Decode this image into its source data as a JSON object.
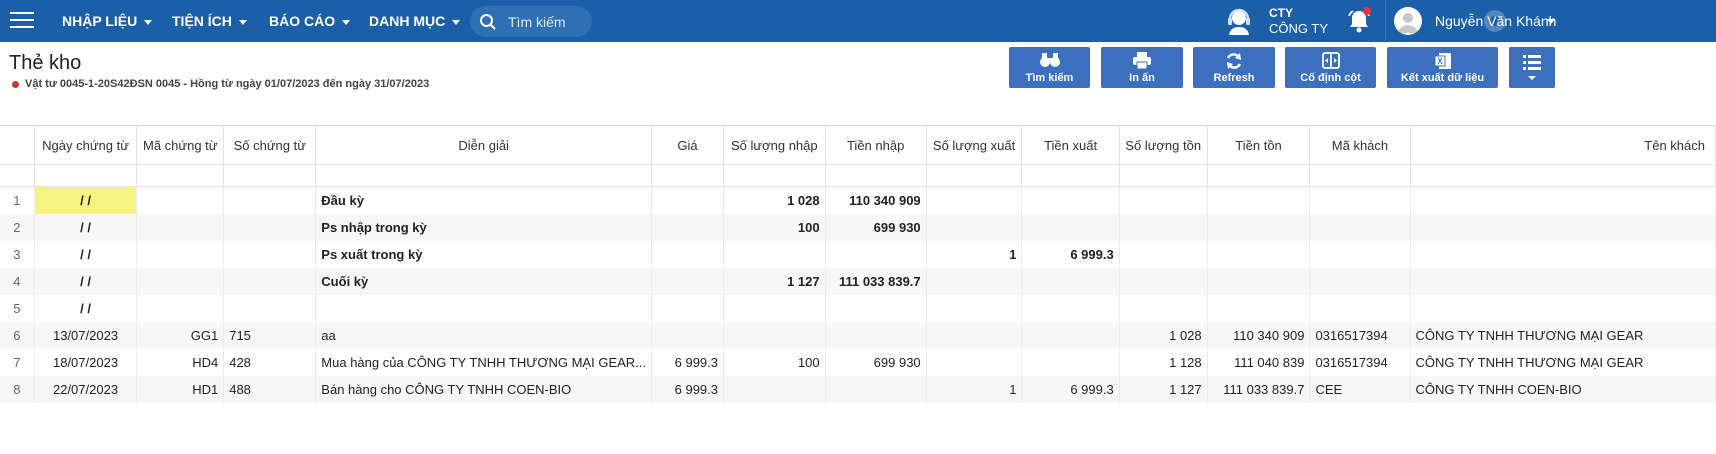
{
  "nav": {
    "menus": [
      "NHẬP LIỆU",
      "TIỆN ÍCH",
      "BÁO CÁO",
      "DANH MỤC"
    ],
    "search_placeholder": "Tìm kiếm",
    "company_short": "CTY",
    "company_name": "CÔNG TY",
    "user_name": "Nguyễn Văn Khánh"
  },
  "page": {
    "title": "Thẻ kho",
    "subtitle": "Vật tư 0045-1-20S42ĐSN 0045 - Hồng từ ngày 01/07/2023 đến ngày 31/07/2023"
  },
  "toolbar": {
    "search_label": "Tìm kiếm",
    "print_label": "In ấn",
    "refresh_label": "Refresh",
    "freeze_label": "Cố định cột",
    "export_label": "Kết xuất dữ liệu"
  },
  "table": {
    "headers": [
      "Ngày chứng từ",
      "Mã chứng từ",
      "Số chứng từ",
      "Diễn giải",
      "Giá",
      "Số lượng nhập",
      "Tiền nhập",
      "Số lượng xuất",
      "Tiền xuất",
      "Số lượng tồn",
      "Tiền tồn",
      "Mã khách",
      "Tên khách"
    ],
    "rows": [
      {
        "rn": "1",
        "cells": [
          "/ /",
          "",
          "",
          "Đầu kỳ",
          "",
          "1 028",
          "110 340 909",
          "",
          "",
          "",
          "",
          "",
          ""
        ]
      },
      {
        "rn": "2",
        "cells": [
          "/ /",
          "",
          "",
          "Ps nhập trong kỳ",
          "",
          "100",
          "699 930",
          "",
          "",
          "",
          "",
          "",
          ""
        ]
      },
      {
        "rn": "3",
        "cells": [
          "/ /",
          "",
          "",
          "Ps xuất trong kỳ",
          "",
          "",
          "",
          "1",
          "6 999.3",
          "",
          "",
          "",
          ""
        ]
      },
      {
        "rn": "4",
        "cells": [
          "/ /",
          "",
          "",
          "Cuối kỳ",
          "",
          "1 127",
          "111 033 839.7",
          "",
          "",
          "",
          "",
          "",
          ""
        ]
      },
      {
        "rn": "5",
        "cells": [
          "/ /",
          "",
          "",
          "",
          "",
          "",
          "",
          "",
          "",
          "",
          "",
          "",
          ""
        ]
      },
      {
        "rn": "6",
        "cells": [
          "13/07/2023",
          "GG1",
          "715",
          "aa",
          "",
          "",
          "",
          "",
          "",
          "1 028",
          "110 340 909",
          "0316517394",
          "CÔNG TY TNHH THƯƠNG MẠI GEAR"
        ]
      },
      {
        "rn": "7",
        "cells": [
          "18/07/2023",
          "HD4",
          "428",
          "Mua hàng của CÔNG TY TNHH THƯƠNG MẠI GEAR...",
          "6 999.3",
          "100",
          "699 930",
          "",
          "",
          "1 128",
          "111 040 839",
          "0316517394",
          "CÔNG TY TNHH THƯƠNG MẠI GEAR"
        ]
      },
      {
        "rn": "8",
        "cells": [
          "22/07/2023",
          "HD1",
          "488",
          "Bán hàng cho CÔNG TY TNHH COEN-BIO",
          "6 999.3",
          "",
          "",
          "1",
          "6 999.3",
          "1 127",
          "111 033 839.7",
          "CEE",
          "CÔNG TY TNHH COEN-BIO"
        ]
      }
    ]
  },
  "colors": {
    "topbar": "#1b5fa8",
    "button": "#3d6fbf",
    "highlight": "#f6f47e"
  }
}
